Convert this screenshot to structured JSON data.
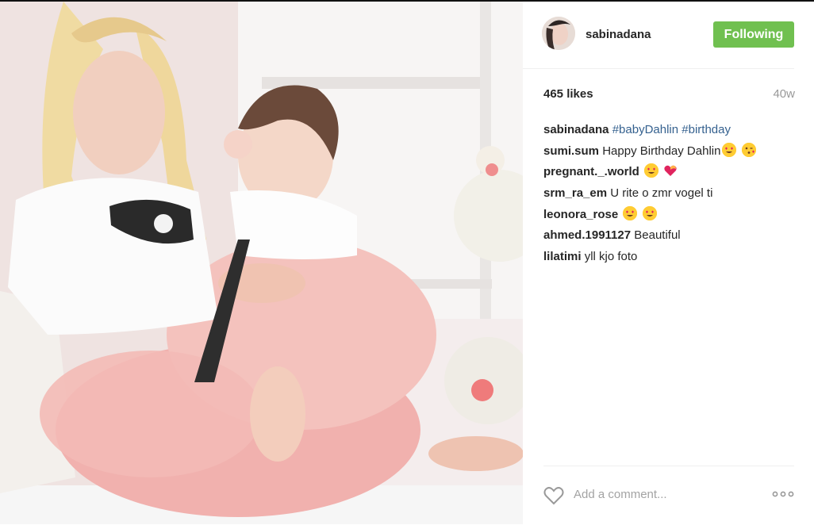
{
  "post": {
    "username": "sabinadana",
    "follow_label": "Following",
    "follow_color": "#70c050",
    "likes": "465 likes",
    "age": "40w",
    "caption": {
      "user": "sabinadana",
      "hashtags": [
        "#babyDahlin",
        "#birthday"
      ]
    },
    "comments": [
      {
        "user": "sumi.sum",
        "text": "Happy Birthday Dahlin",
        "emoji": [
          "heart-eyes-emoji",
          "kissing-wink-emoji"
        ]
      },
      {
        "user": "pregnant._.world",
        "text": "",
        "emoji": [
          "heart-eyes-emoji",
          "heart-emoji"
        ]
      },
      {
        "user": "srm_ra_em",
        "text": "U rite o zmr vogel ti",
        "emoji": []
      },
      {
        "user": "leonora_rose",
        "text": "",
        "emoji": [
          "heart-eyes-emoji",
          "heart-eyes-emoji"
        ]
      },
      {
        "user": "ahmed.1991127",
        "text": "Beautiful",
        "emoji": []
      },
      {
        "user": "lilatimi",
        "text": "yll kjo foto",
        "emoji": []
      }
    ],
    "add_comment_placeholder": "Add a comment...",
    "icons": {
      "like": "heart-outline-icon",
      "options": "more-options-icon"
    },
    "hashtag_color": "#35618f"
  }
}
